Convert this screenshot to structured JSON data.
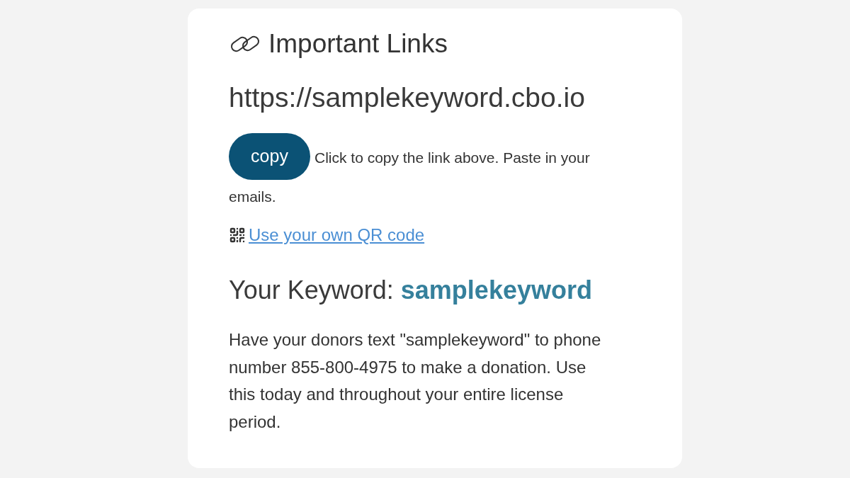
{
  "card": {
    "title": "Important Links",
    "url": "https://samplekeyword.cbo.io",
    "copy_button": "copy",
    "copy_hint_lines": [
      "Click to copy the link above. Paste in your",
      "emails."
    ],
    "qr_link": "Use your own QR code",
    "keyword_label": "Your Keyword:",
    "keyword": "samplekeyword",
    "description": "Have your donors text \"samplekeyword\" to phone number 855-800-4975 to make a donation. Use this today and throughout your entire license period."
  }
}
